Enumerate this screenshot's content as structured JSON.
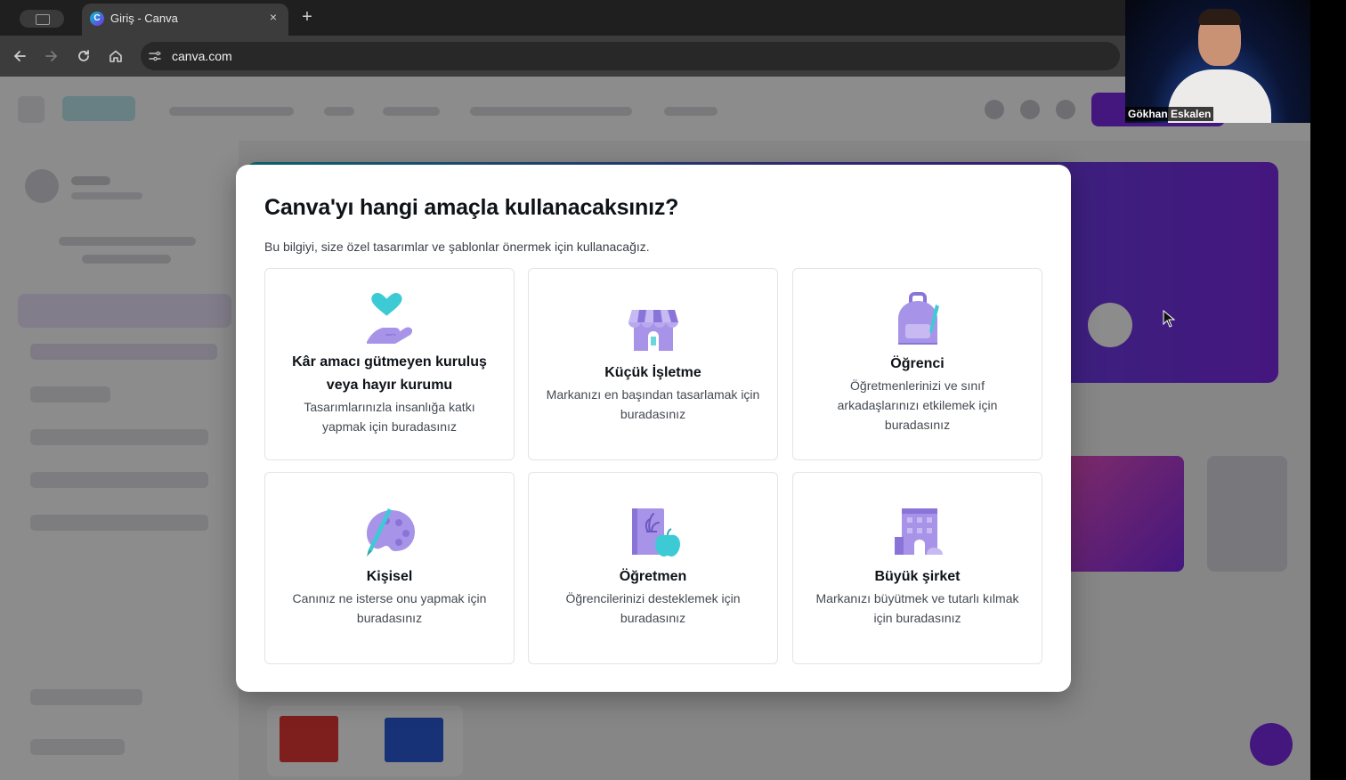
{
  "browser": {
    "tab_title": "Giriş - Canva",
    "favicon_letter": "C",
    "close_glyph": "×",
    "new_tab_glyph": "+",
    "url": "canva.com",
    "icons": [
      "back-arrow-icon",
      "forward-arrow-icon",
      "reload-icon",
      "home-icon",
      "site-settings-icon"
    ]
  },
  "modal": {
    "title": "Canva'yı hangi amaçla kullanacaksınız?",
    "subtitle": "Bu bilgiyi, size özel tasarımlar ve şablonlar önermek için kullanacağız.",
    "options": [
      {
        "title": "Kâr amacı gütmeyen kuruluş veya hayır kurumu",
        "description": "Tasarımlarınızla insanlığa katkı yapmak için buradasınız",
        "icon": "heart-hand-icon"
      },
      {
        "title": "Küçük İşletme",
        "description": "Markanızı en başından tasarlamak için buradasınız",
        "icon": "storefront-icon"
      },
      {
        "title": "Öğrenci",
        "description": "Öğretmenlerinizi ve sınıf arkadaşlarınızı etkilemek için buradasınız",
        "icon": "backpack-icon"
      },
      {
        "title": "Kişisel",
        "description": "Canınız ne isterse onu yapmak için buradasınız",
        "icon": "paint-palette-icon"
      },
      {
        "title": "Öğretmen",
        "description": "Öğrencilerinizi desteklemek için buradasınız",
        "icon": "notebook-apple-icon"
      },
      {
        "title": "Büyük şirket",
        "description": "Markanızı büyütmek ve tutarlı kılmak için buradasınız",
        "icon": "office-building-icon"
      }
    ]
  },
  "video": {
    "name": "Gökhan Eskalen"
  },
  "colors": {
    "accent_purple": "#7d2ae8",
    "icon_lavender": "#a794e8",
    "icon_teal": "#3ccbd4",
    "canva_teal": "#17b6c8"
  }
}
